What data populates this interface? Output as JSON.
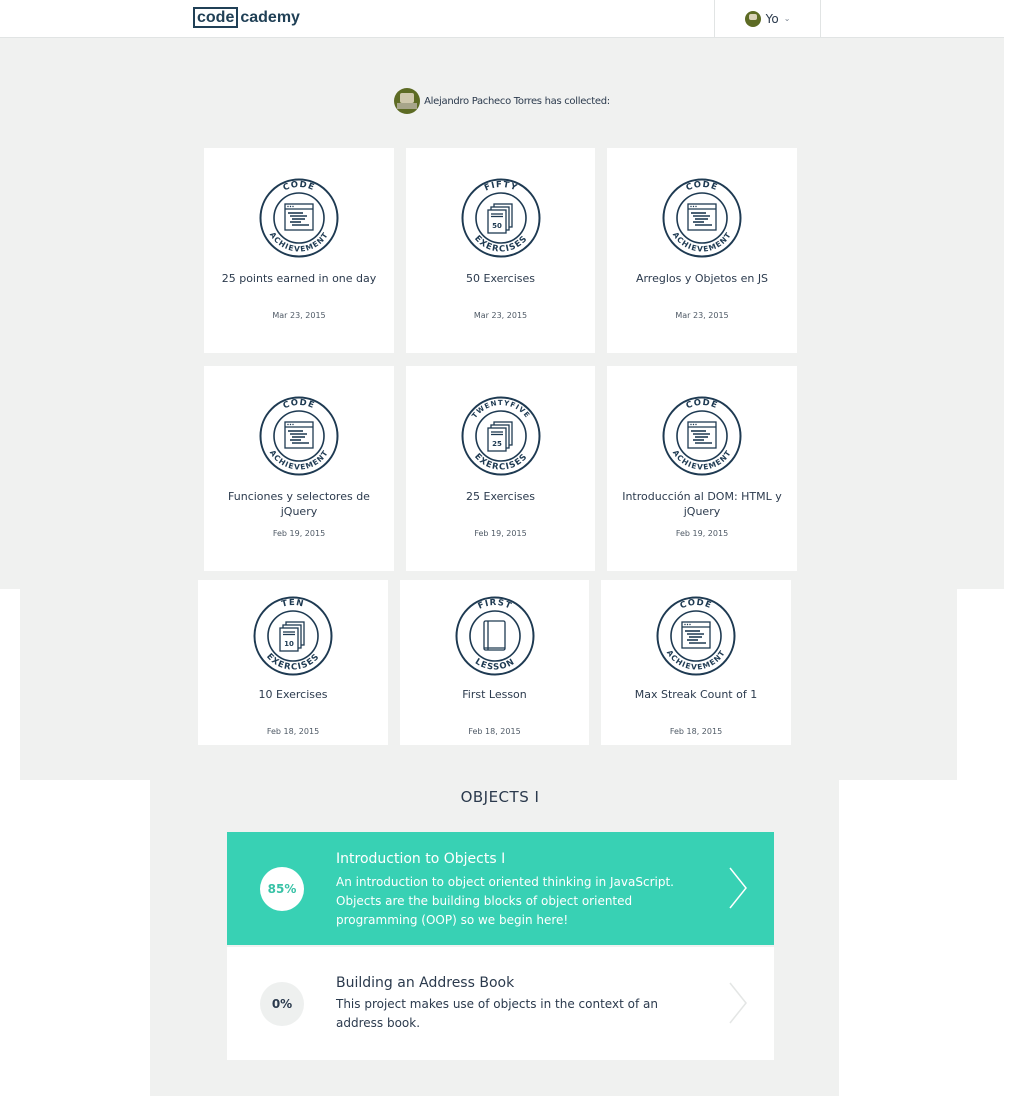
{
  "header": {
    "logo_box": "code",
    "logo_rest": "cademy",
    "user_label": "Yo"
  },
  "profile": {
    "collected_text": "Alejandro Pacheco Torres has collected:"
  },
  "achievements": [
    {
      "title": "25 points earned in one day",
      "date": "Mar 23, 2015",
      "badge_top": "CODE",
      "badge_bottom": "ACHIEVEMENT",
      "icon": "code-window-icon"
    },
    {
      "title": "50 Exercises",
      "date": "Mar 23, 2015",
      "badge_top": "FIFTY",
      "badge_bottom": "EXERCISES",
      "badge_num": "50",
      "icon": "exercises-stack-icon"
    },
    {
      "title": "Arreglos y Objetos en JS",
      "date": "Mar 23, 2015",
      "badge_top": "CODE",
      "badge_bottom": "ACHIEVEMENT",
      "icon": "code-window-icon"
    },
    {
      "title": "Funciones y selectores de jQuery",
      "date": "Feb 19, 2015",
      "badge_top": "CODE",
      "badge_bottom": "ACHIEVEMENT",
      "icon": "code-window-icon"
    },
    {
      "title": "25 Exercises",
      "date": "Feb 19, 2015",
      "badge_top": "TWENTYFIVE",
      "badge_bottom": "EXERCISES",
      "badge_num": "25",
      "icon": "exercises-stack-icon"
    },
    {
      "title": "Introducción al DOM: HTML y jQuery",
      "date": "Feb 19, 2015",
      "badge_top": "CODE",
      "badge_bottom": "ACHIEVEMENT",
      "icon": "code-window-icon"
    },
    {
      "title": "10 Exercises",
      "date": "Feb 18, 2015",
      "badge_top": "TEN",
      "badge_bottom": "EXERCISES",
      "badge_num": "10",
      "icon": "exercises-stack-icon"
    },
    {
      "title": "First Lesson",
      "date": "Feb 18, 2015",
      "badge_top": "FIRST",
      "badge_bottom": "LESSON",
      "icon": "book-icon"
    },
    {
      "title": "Max Streak Count of 1",
      "date": "Feb 18, 2015",
      "badge_top": "CODE",
      "badge_bottom": "ACHIEVEMENT",
      "icon": "code-window-icon"
    }
  ],
  "section": {
    "title": "OBJECTS I",
    "lessons": [
      {
        "progress": "85%",
        "title": "Introduction to Objects I",
        "description": "An introduction to object oriented thinking in JavaScript. Objects are the building blocks of object oriented programming (OOP) so we begin here!"
      },
      {
        "progress": "0%",
        "title": "Building an Address Book",
        "description": "This project makes use of objects in the context of an address book."
      }
    ]
  },
  "colors": {
    "accent": "#38d1b4",
    "badge_stroke": "#1e3a52",
    "panel_bg": "#f0f1f0"
  }
}
